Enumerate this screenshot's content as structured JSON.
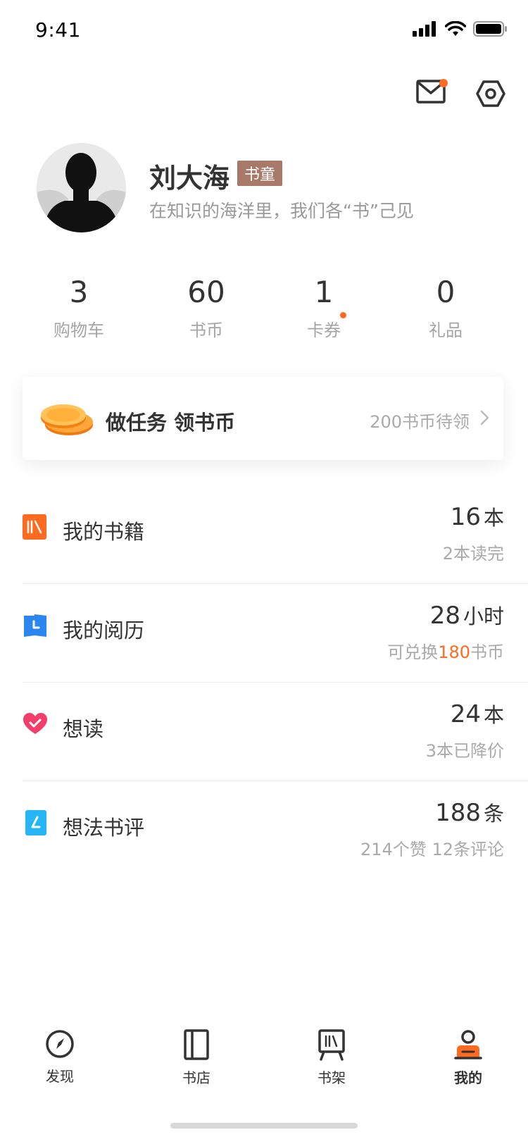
{
  "status_bar": {
    "time": "9:41"
  },
  "header": {
    "mail_icon": "mail-icon",
    "settings_icon": "settings-icon",
    "has_unread": true
  },
  "profile": {
    "name": "刘大海",
    "badge": "书童",
    "slogan": "在知识的海洋里，我们各“书”己见"
  },
  "stats": [
    {
      "value": "3",
      "label": "购物车"
    },
    {
      "value": "60",
      "label": "书币"
    },
    {
      "value": "1",
      "label": "卡券"
    },
    {
      "value": "0",
      "label": "礼品"
    }
  ],
  "task": {
    "title": "做任务 领书币",
    "right_text": "200书币待领"
  },
  "list": [
    {
      "title": "我的书籍",
      "num": "16",
      "unit": "本",
      "sub": "2本读完",
      "icon": "books-icon",
      "color": "#ff6a21"
    },
    {
      "title": "我的阅历",
      "num": "28",
      "unit": "小时",
      "sub_prefix": "可兑换",
      "sub_highlight": "180",
      "sub_suffix": "书币",
      "icon": "clock-icon",
      "color": "#2b86f0"
    },
    {
      "title": "想读",
      "num": "24",
      "unit": "本",
      "sub": "3本已降价",
      "icon": "heart-icon",
      "color": "#f33e6a"
    },
    {
      "title": "想法书评",
      "num": "188",
      "unit": "条",
      "sub": "214个赞 12条评论",
      "icon": "note-icon",
      "color": "#26b6f5"
    }
  ],
  "tabbar": [
    {
      "label": "发现",
      "icon": "compass-icon"
    },
    {
      "label": "书店",
      "icon": "book-icon"
    },
    {
      "label": "书架",
      "icon": "bookshelf-icon"
    },
    {
      "label": "我的",
      "icon": "profile-icon",
      "active": true
    }
  ],
  "colors": {
    "accent": "#ff6a21",
    "badge": "#a87869"
  }
}
